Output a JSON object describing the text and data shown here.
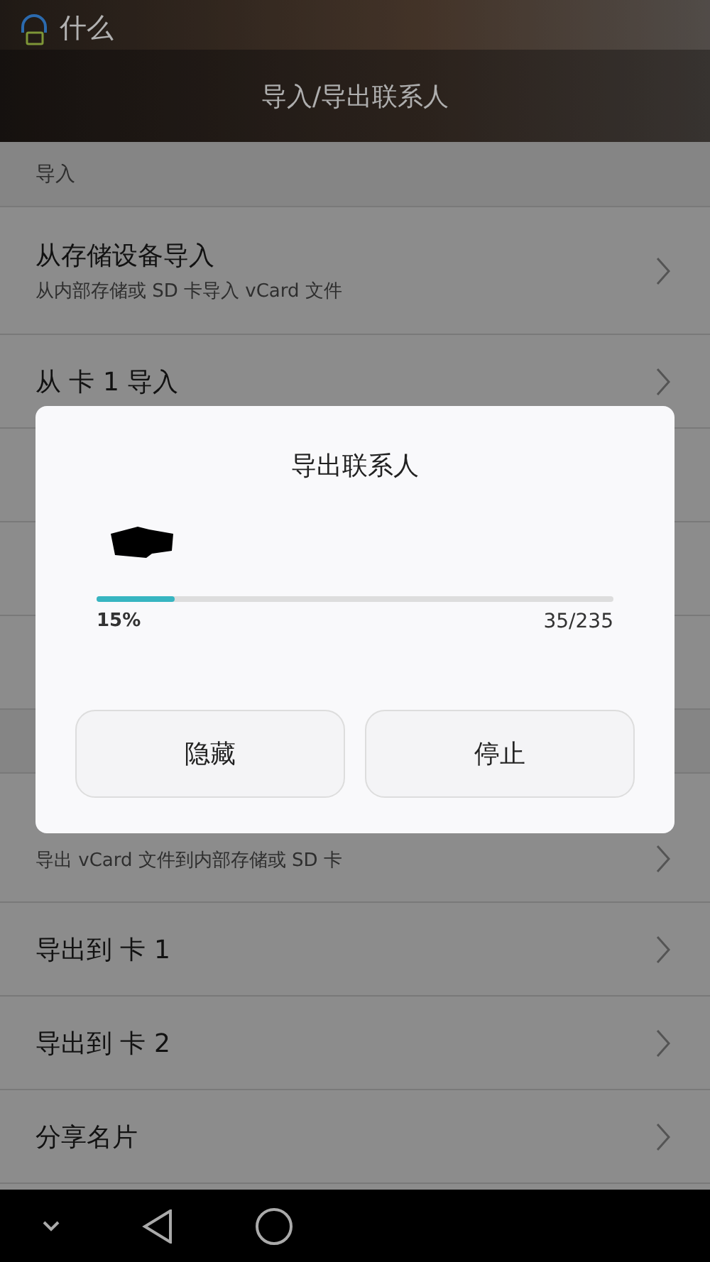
{
  "notification": {
    "text": "什么"
  },
  "app_bar": {
    "title": "导入/导出联系人"
  },
  "sections": [
    {
      "header": "导入",
      "rows": [
        {
          "title": "从存储设备导入",
          "subtitle": "从内部存储或 SD 卡导入 vCard 文件"
        },
        {
          "title": "从 卡 1 导入"
        }
      ]
    }
  ],
  "export_rows": [
    {
      "subtitle": "导出 vCard 文件到内部存储或 SD 卡"
    },
    {
      "title": "导出到 卡 1"
    },
    {
      "title": "导出到 卡 2"
    },
    {
      "title": "分享名片"
    }
  ],
  "dialog": {
    "title": "导出联系人",
    "progress": {
      "level": 0.15,
      "percent": "15%",
      "count": "35/235"
    },
    "buttons": [
      "隐藏",
      "停止"
    ]
  }
}
